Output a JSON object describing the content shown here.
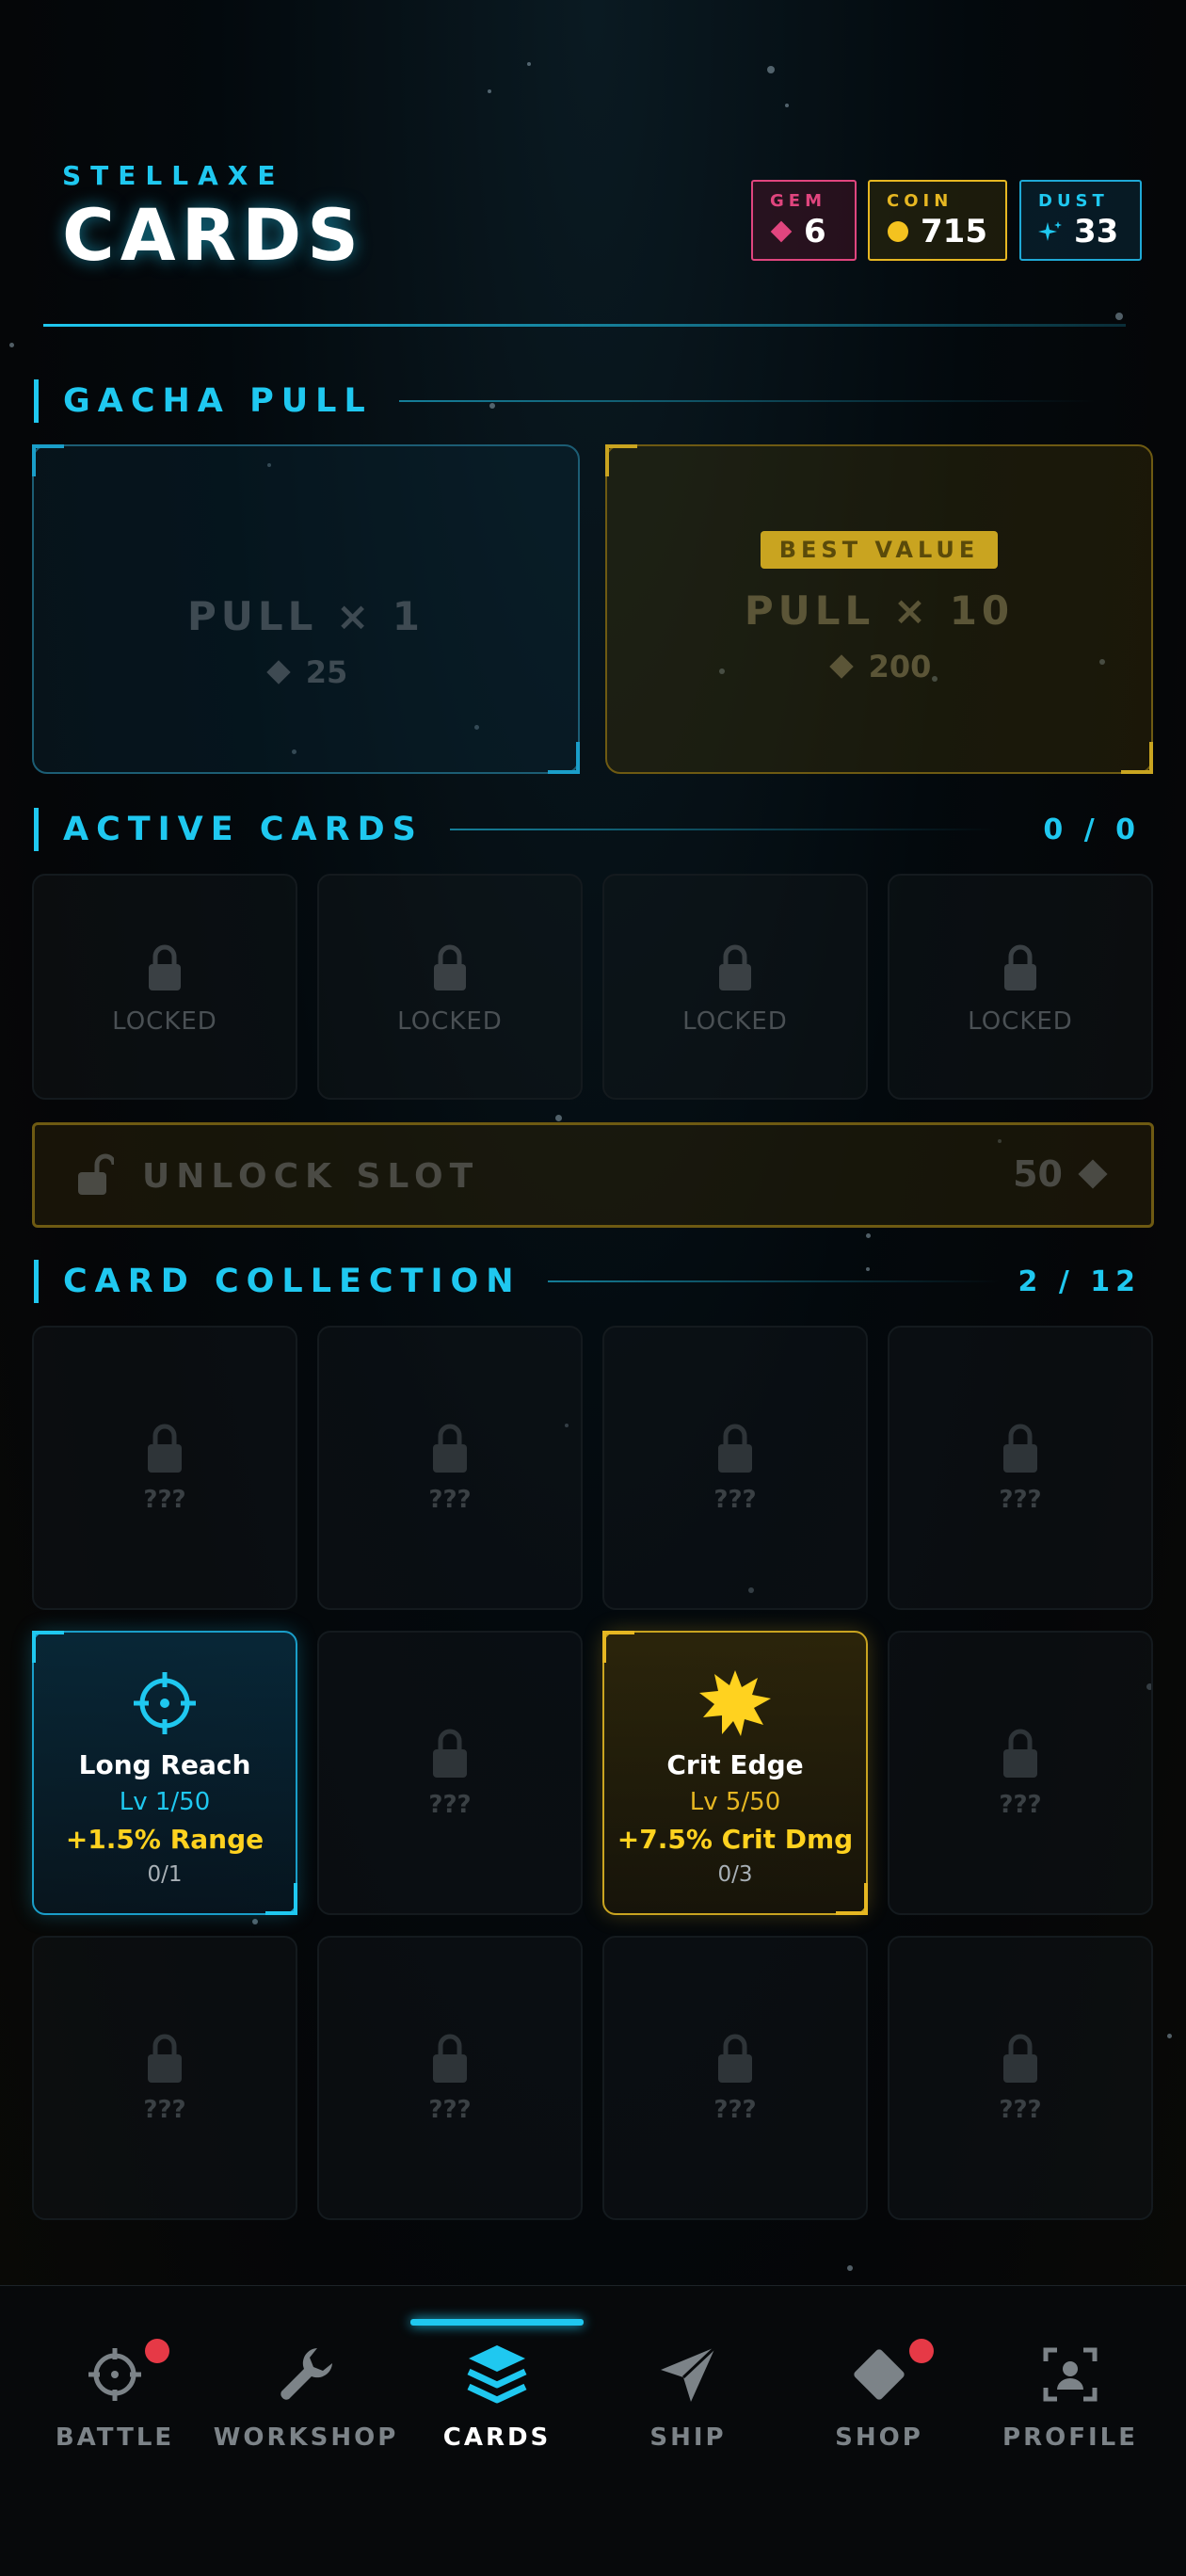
{
  "header": {
    "brand": "STELLAXE",
    "title": "CARDS"
  },
  "currencies": {
    "gem": {
      "label": "GEM",
      "value": "6",
      "color": "#e0457e"
    },
    "coin": {
      "label": "COIN",
      "value": "715",
      "color": "#e6b722"
    },
    "dust": {
      "label": "DUST",
      "value": "33",
      "color": "#1fc8f0"
    }
  },
  "gacha": {
    "title": "GACHA PULL",
    "pull1": {
      "label": "PULL × 1",
      "cost": "25"
    },
    "pull10": {
      "badge": "BEST VALUE",
      "label": "PULL × 10",
      "cost": "200"
    }
  },
  "active": {
    "title": "ACTIVE CARDS",
    "count": "0 / 0",
    "slot_label": "LOCKED"
  },
  "unlock": {
    "label": "UNLOCK SLOT",
    "cost": "50"
  },
  "collection": {
    "title": "CARD COLLECTION",
    "count": "2 / 12",
    "locked_label": "???",
    "cards": [
      {
        "name": "Long Reach",
        "level": "Lv 1/50",
        "bonus": "+1.5% Range",
        "progress": "0/1",
        "icon": "crosshair-icon"
      },
      {
        "name": "Crit Edge",
        "level": "Lv 5/50",
        "bonus": "+7.5% Crit Dmg",
        "progress": "0/3",
        "icon": "burst-icon"
      }
    ]
  },
  "nav": {
    "battle": "BATTLE",
    "workshop": "WORKSHOP",
    "cards": "CARDS",
    "ship": "SHIP",
    "shop": "SHOP",
    "profile": "PROFILE"
  },
  "colors": {
    "accent": "#1fc8f0",
    "gold": "#e6b722",
    "gem": "#e0457e",
    "badge": "#e63946"
  }
}
